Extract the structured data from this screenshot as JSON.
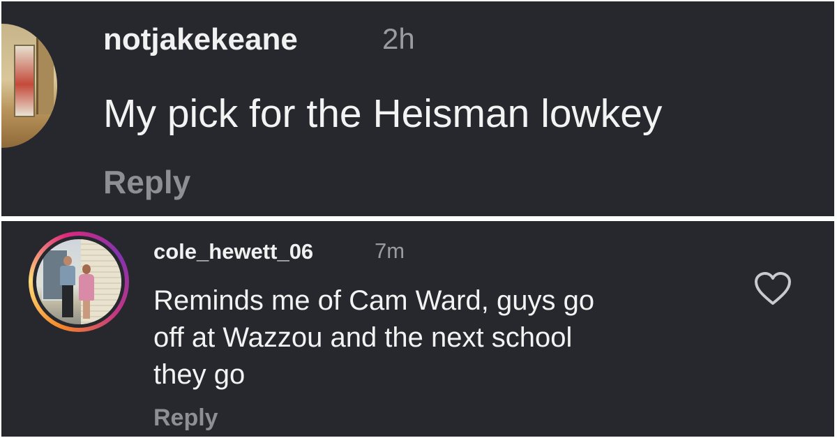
{
  "top_comment": {
    "username": "notjakekeane",
    "time": "2h",
    "text": "My pick for the Heisman lowkey",
    "reply_label": "Reply"
  },
  "bottom_comment": {
    "username": "cole_hewett_06",
    "time": "7m",
    "text_lines": [
      "Reminds me of Cam Ward, guys go",
      "off at Wazzou and the next school",
      "they go"
    ],
    "reply_label": "Reply",
    "like_icon": "heart-outline-icon"
  },
  "colors": {
    "background": "#27282e",
    "primary_text": "#f3f3f3",
    "secondary_text": "#9a9ba0",
    "story_ring": [
      "#f58529",
      "#feda77",
      "#dd2a7b",
      "#8134af"
    ]
  }
}
